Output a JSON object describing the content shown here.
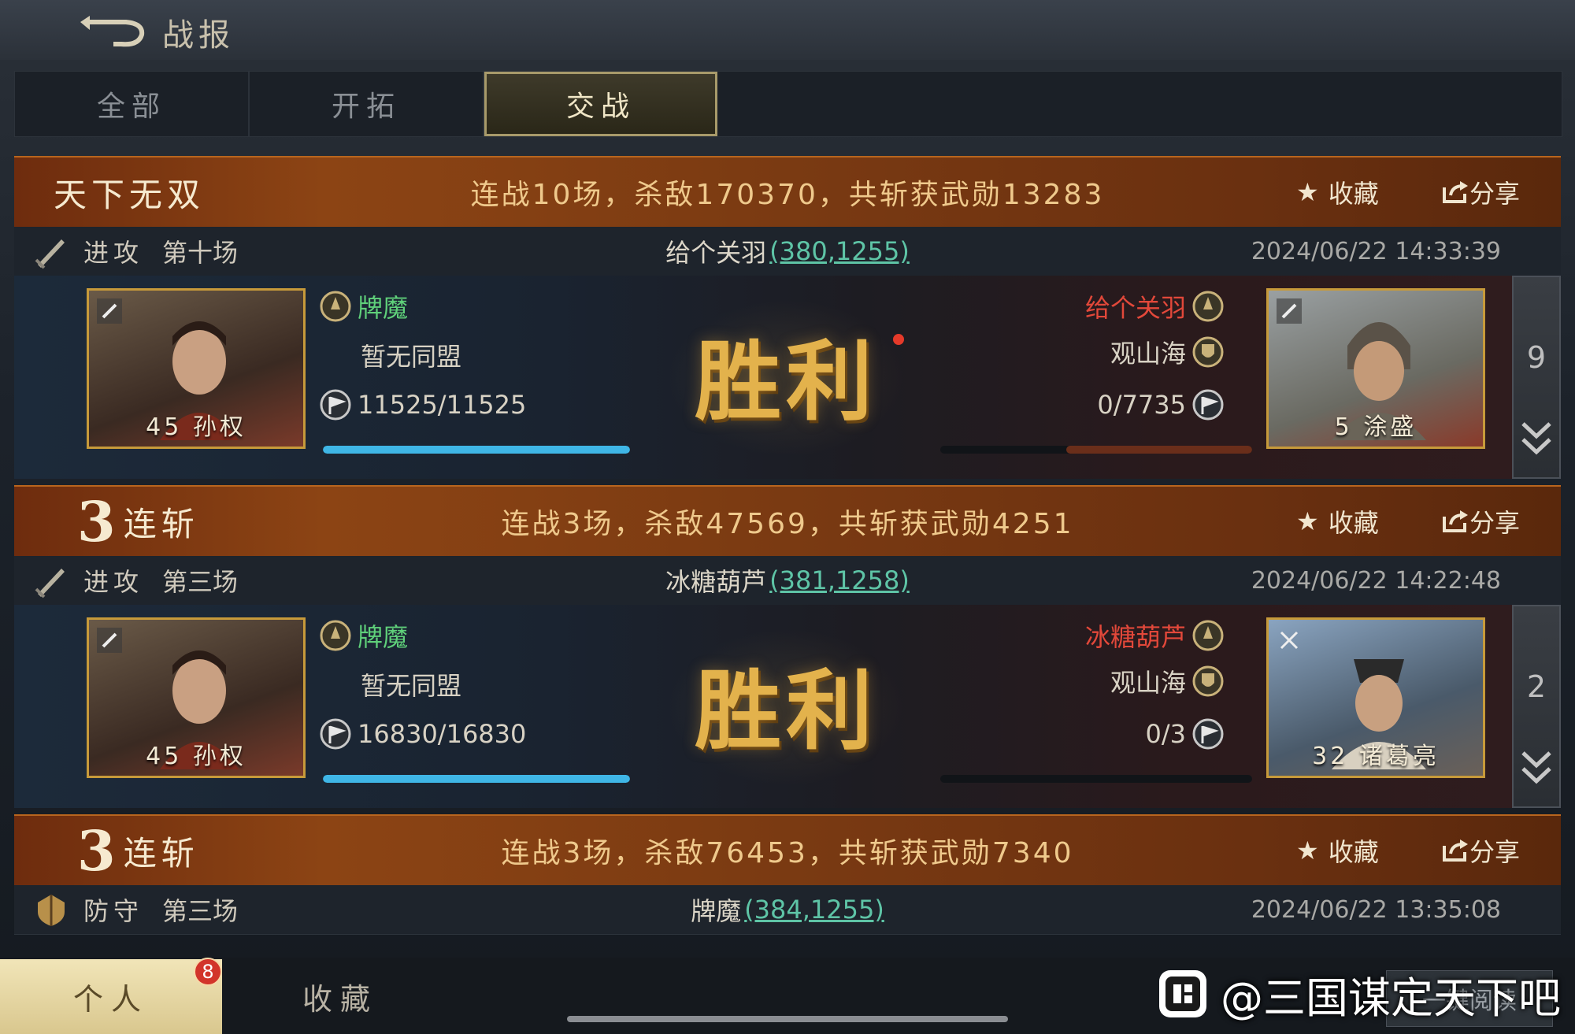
{
  "header": {
    "title": "战报",
    "back_icon": "back-arrow-icon"
  },
  "tabs": [
    {
      "label": "全部",
      "active": false
    },
    {
      "label": "开拓",
      "active": false
    },
    {
      "label": "交战",
      "active": true
    }
  ],
  "reports": [
    {
      "banner_title": "天下无双",
      "banner_count": "",
      "summary": "连战10场，杀敌170370，共斩获武勋13283",
      "favorite_label": "收藏",
      "share_label": "分享",
      "kind": "进攻",
      "round": "第十场",
      "target_name": "给个关羽",
      "target_coord": "(380,1255)",
      "time": "2024/06/22 14:33:39",
      "result": "胜利",
      "left": {
        "name": "牌魔",
        "alliance": "暂无同盟",
        "troops": "11525/11525",
        "troops_fraction": 1.0,
        "general_level": "45",
        "general_name": "孙权"
      },
      "right": {
        "name": "给个关羽",
        "alliance": "观山海",
        "troops": "0/7735",
        "troops_fraction": 0.0,
        "general_level": "5",
        "general_name": "涂盛"
      },
      "side_count": "9",
      "unread": true
    },
    {
      "banner_title": "连斩",
      "banner_count": "3",
      "summary": "连战3场，杀敌47569，共斩获武勋4251",
      "favorite_label": "收藏",
      "share_label": "分享",
      "kind": "进攻",
      "round": "第三场",
      "target_name": "冰糖葫芦",
      "target_coord": "(381,1258)",
      "time": "2024/06/22 14:22:48",
      "result": "胜利",
      "left": {
        "name": "牌魔",
        "alliance": "暂无同盟",
        "troops": "16830/16830",
        "troops_fraction": 1.0,
        "general_level": "45",
        "general_name": "孙权"
      },
      "right": {
        "name": "冰糖葫芦",
        "alliance": "观山海",
        "troops": "0/3",
        "troops_fraction": 0.0,
        "general_level": "32",
        "general_name": "诸葛亮"
      },
      "side_count": "2",
      "unread": false
    },
    {
      "banner_title": "连斩",
      "banner_count": "3",
      "summary": "连战3场，杀敌76453，共斩获武勋7340",
      "favorite_label": "收藏",
      "share_label": "分享",
      "kind": "防守",
      "round": "第三场",
      "target_name": "牌魔",
      "target_coord": "(384,1255)",
      "time": "2024/06/22 13:35:08"
    }
  ],
  "bottom": {
    "personal_label": "个人",
    "personal_badge": "8",
    "favorites_label": "收藏",
    "one_click_read": "一键阅读",
    "watermark": "@三国谋定天下吧"
  },
  "colors": {
    "ally_name": "#5fd07a",
    "enemy_name": "#e2483a",
    "coord": "#5ec4a6",
    "hp_bar": "#3fb6e6",
    "enemy_bar": "#8a3a22",
    "banner": "#8c4414",
    "victory": "#e3b24c"
  }
}
